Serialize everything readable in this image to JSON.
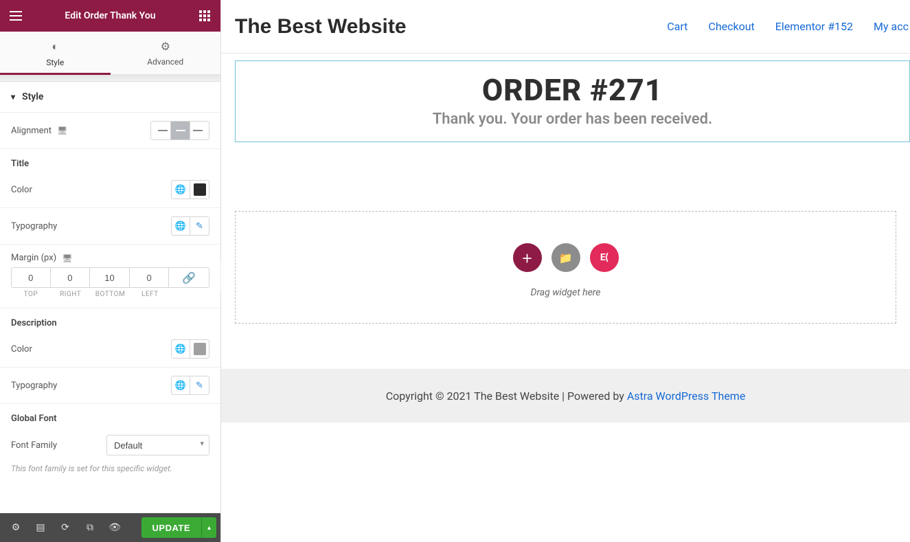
{
  "panel": {
    "header_title": "Edit Order Thank You",
    "tabs": {
      "style": "Style",
      "advanced": "Advanced"
    },
    "accordion": {
      "style": "Style"
    },
    "alignment_label": "Alignment",
    "sections": {
      "title": "Title",
      "description": "Description",
      "global_font": "Global Font"
    },
    "color_label": "Color",
    "typography_label": "Typography",
    "margin_label": "Margin (px)",
    "margin": {
      "top": "0",
      "right": "0",
      "bottom": "10",
      "left": "0"
    },
    "margin_sublabels": {
      "top": "TOP",
      "right": "RIGHT",
      "bottom": "BOTTOM",
      "left": "LEFT"
    },
    "font_family_label": "Font Family",
    "font_family_value": "Default",
    "font_hint": "This font family is set for this specific widget.",
    "colors": {
      "title_swatch": "#2a2a2a",
      "desc_swatch": "#a0a0a0"
    },
    "footer": {
      "update": "UPDATE"
    }
  },
  "preview": {
    "site_title": "The Best Website",
    "nav": [
      "Cart",
      "Checkout",
      "Elementor #152",
      "My acc"
    ],
    "order_title": "ORDER #271",
    "order_thanks": "Thank you. Your order has been received.",
    "drop_text": "Drag widget here",
    "footer_text": "Copyright © 2021 The Best Website | Powered by ",
    "footer_link": "Astra WordPress Theme"
  }
}
